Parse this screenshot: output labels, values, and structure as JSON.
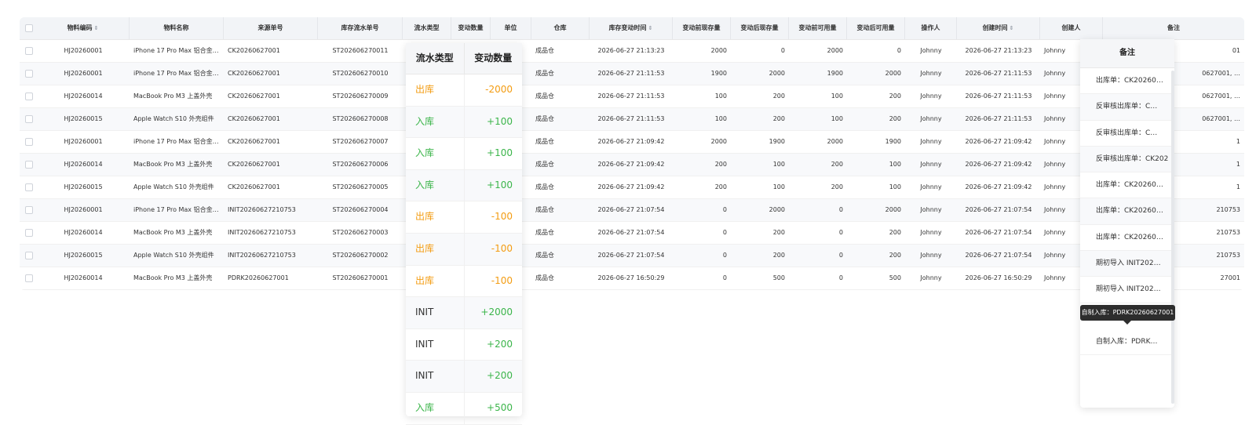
{
  "colors": {
    "out": "#f39c12",
    "in": "#3bb54a",
    "neutral": "#333333"
  },
  "table": {
    "headers": {
      "code": "物料编码",
      "name": "物料名称",
      "src": "来源单号",
      "stock": "库存流水单号",
      "type": "流水类型",
      "qty": "变动数量",
      "unit": "单位",
      "wh": "仓库",
      "time": "库存变动时间",
      "b_on": "变动前现存量",
      "a_on": "变动后现存量",
      "b_av": "变动前可用量",
      "a_av": "变动后可用量",
      "op": "操作人",
      "created": "创建时间",
      "creator": "创建人",
      "remark": "备注"
    },
    "rows": [
      {
        "code": "HJ20260001",
        "name": "iPhone 17 Pro Max 铝合金…",
        "src": "CK20260627001",
        "stock": "ST202606270011",
        "wh": "成品仓",
        "time": "2026-06-27 21:13:23",
        "b_on": "2000",
        "a_on": "0",
        "b_av": "2000",
        "a_av": "0",
        "op": "Johnny",
        "created": "2026-06-27 21:13:23",
        "creator": "Johnny",
        "remark": "01"
      },
      {
        "code": "HJ20260001",
        "name": "iPhone 17 Pro Max 铝合金…",
        "src": "CK20260627001",
        "stock": "ST202606270010",
        "wh": "成品仓",
        "time": "2026-06-27 21:11:53",
        "b_on": "1900",
        "a_on": "2000",
        "b_av": "1900",
        "a_av": "2000",
        "op": "Johnny",
        "created": "2026-06-27 21:11:53",
        "creator": "Johnny",
        "remark": "0627001, …"
      },
      {
        "code": "HJ20260014",
        "name": "MacBook Pro M3 上盖外壳",
        "src": "CK20260627001",
        "stock": "ST202606270009",
        "wh": "成品仓",
        "time": "2026-06-27 21:11:53",
        "b_on": "100",
        "a_on": "200",
        "b_av": "100",
        "a_av": "200",
        "op": "Johnny",
        "created": "2026-06-27 21:11:53",
        "creator": "Johnny",
        "remark": "0627001, …"
      },
      {
        "code": "HJ20260015",
        "name": "Apple Watch S10 外壳组件",
        "src": "CK20260627001",
        "stock": "ST202606270008",
        "wh": "成品仓",
        "time": "2026-06-27 21:11:53",
        "b_on": "100",
        "a_on": "200",
        "b_av": "100",
        "a_av": "200",
        "op": "Johnny",
        "created": "2026-06-27 21:11:53",
        "creator": "Johnny",
        "remark": "0627001, …"
      },
      {
        "code": "HJ20260001",
        "name": "iPhone 17 Pro Max 铝合金…",
        "src": "CK20260627001",
        "stock": "ST202606270007",
        "wh": "成品仓",
        "time": "2026-06-27 21:09:42",
        "b_on": "2000",
        "a_on": "1900",
        "b_av": "2000",
        "a_av": "1900",
        "op": "Johnny",
        "created": "2026-06-27 21:09:42",
        "creator": "Johnny",
        "remark": "1"
      },
      {
        "code": "HJ20260014",
        "name": "MacBook Pro M3 上盖外壳",
        "src": "CK20260627001",
        "stock": "ST202606270006",
        "wh": "成品仓",
        "time": "2026-06-27 21:09:42",
        "b_on": "200",
        "a_on": "100",
        "b_av": "200",
        "a_av": "100",
        "op": "Johnny",
        "created": "2026-06-27 21:09:42",
        "creator": "Johnny",
        "remark": "1"
      },
      {
        "code": "HJ20260015",
        "name": "Apple Watch S10 外壳组件",
        "src": "CK20260627001",
        "stock": "ST202606270005",
        "wh": "成品仓",
        "time": "2026-06-27 21:09:42",
        "b_on": "200",
        "a_on": "100",
        "b_av": "200",
        "a_av": "100",
        "op": "Johnny",
        "created": "2026-06-27 21:09:42",
        "creator": "Johnny",
        "remark": "1"
      },
      {
        "code": "HJ20260001",
        "name": "iPhone 17 Pro Max 铝合金…",
        "src": "INIT20260627210753",
        "stock": "ST202606270004",
        "wh": "成品仓",
        "time": "2026-06-27 21:07:54",
        "b_on": "0",
        "a_on": "2000",
        "b_av": "0",
        "a_av": "2000",
        "op": "Johnny",
        "created": "2026-06-27 21:07:54",
        "creator": "Johnny",
        "remark": "210753"
      },
      {
        "code": "HJ20260014",
        "name": "MacBook Pro M3 上盖外壳",
        "src": "INIT20260627210753",
        "stock": "ST202606270003",
        "wh": "成品仓",
        "time": "2026-06-27 21:07:54",
        "b_on": "0",
        "a_on": "200",
        "b_av": "0",
        "a_av": "200",
        "op": "Johnny",
        "created": "2026-06-27 21:07:54",
        "creator": "Johnny",
        "remark": "210753"
      },
      {
        "code": "HJ20260015",
        "name": "Apple Watch S10 外壳组件",
        "src": "INIT20260627210753",
        "stock": "ST202606270002",
        "wh": "成品仓",
        "time": "2026-06-27 21:07:54",
        "b_on": "0",
        "a_on": "200",
        "b_av": "0",
        "a_av": "200",
        "op": "Johnny",
        "created": "2026-06-27 21:07:54",
        "creator": "Johnny",
        "remark": "210753"
      },
      {
        "code": "HJ20260014",
        "name": "MacBook Pro M3 上盖外壳",
        "src": "PDRK20260627001",
        "stock": "ST202606270001",
        "wh": "成品仓",
        "time": "2026-06-27 16:50:29",
        "b_on": "0",
        "a_on": "500",
        "b_av": "0",
        "a_av": "500",
        "op": "Johnny",
        "created": "2026-06-27 16:50:29",
        "creator": "Johnny",
        "remark": "27001"
      }
    ]
  },
  "popover_type": {
    "header_type": "流水类型",
    "header_qty": "变动数量",
    "rows": [
      {
        "type": "出库",
        "qty": "-2000",
        "kind": "out"
      },
      {
        "type": "入库",
        "qty": "+100",
        "kind": "in"
      },
      {
        "type": "入库",
        "qty": "+100",
        "kind": "in"
      },
      {
        "type": "入库",
        "qty": "+100",
        "kind": "in"
      },
      {
        "type": "出库",
        "qty": "-100",
        "kind": "out"
      },
      {
        "type": "出库",
        "qty": "-100",
        "kind": "out"
      },
      {
        "type": "出库",
        "qty": "-100",
        "kind": "out"
      },
      {
        "type": "INIT",
        "qty": "+2000",
        "kind": "init"
      },
      {
        "type": "INIT",
        "qty": "+200",
        "kind": "init"
      },
      {
        "type": "INIT",
        "qty": "+200",
        "kind": "init"
      },
      {
        "type": "入库",
        "qty": "+500",
        "kind": "in"
      }
    ]
  },
  "popover_remark": {
    "header": "备注",
    "rows": [
      "出库单：CK20260…",
      "反审核出库单：C…",
      "反审核出库单：C…",
      "反审核出库单：CK202",
      "出库单：CK20260…",
      "出库单：CK20260…",
      "出库单：CK20260…",
      "期初导入 INIT202…",
      "期初导入 INIT202…"
    ],
    "last": "自制入库：PDRK…",
    "tooltip": "自制入库：PDRK20260627001"
  }
}
